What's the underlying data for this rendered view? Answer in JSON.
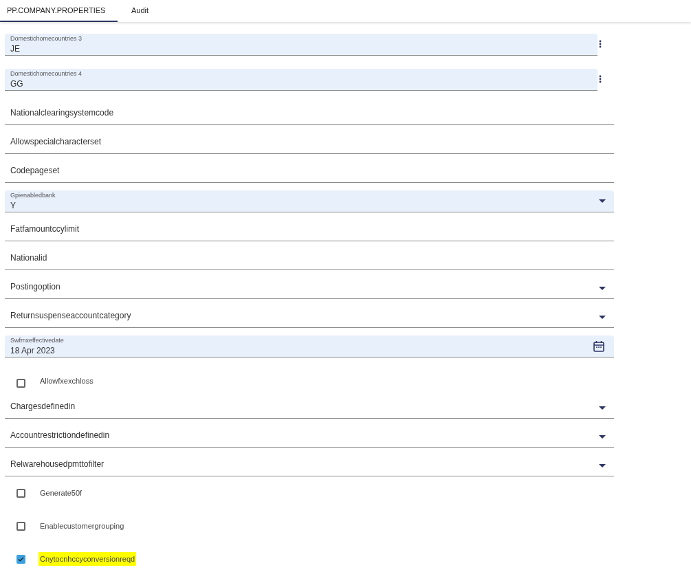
{
  "tabs": [
    {
      "label": "PP.COMPANY.PROPERTIES",
      "selected": true
    },
    {
      "label": "Audit",
      "selected": false
    }
  ],
  "fields": [
    {
      "kind": "menufield",
      "label": "Domestichomecountries 3",
      "value": "JE"
    },
    {
      "kind": "menufield",
      "label": "Domestichomecountries 4",
      "value": "GG"
    },
    {
      "kind": "text",
      "label": "Nationalclearingsystemcode"
    },
    {
      "kind": "text",
      "label": "Allowspecialcharacterset"
    },
    {
      "kind": "text",
      "label": "Codepageset"
    },
    {
      "kind": "dropdown",
      "label": "Gpienabledbank",
      "value": "Y"
    },
    {
      "kind": "text",
      "label": "Fatfamountccylimit"
    },
    {
      "kind": "text",
      "label": "Nationalid"
    },
    {
      "kind": "select",
      "label": "Postingoption"
    },
    {
      "kind": "select",
      "label": "Returnsuspenseaccountcategory"
    },
    {
      "kind": "date",
      "label": "Swfmxeffectivedate",
      "value": "18 Apr 2023"
    },
    {
      "kind": "checkbox",
      "label": "Allowfxexchloss",
      "checked": false,
      "highlighted": false
    },
    {
      "kind": "select",
      "label": "Chargesdefinedin"
    },
    {
      "kind": "select",
      "label": "Accountrestrictiondefinedin"
    },
    {
      "kind": "select",
      "label": "Relwarehousedpmttofilter"
    },
    {
      "kind": "checkbox",
      "label": "Generate50f",
      "checked": false,
      "highlighted": false
    },
    {
      "kind": "checkbox",
      "label": "Enablecustomergrouping",
      "checked": false,
      "highlighted": false
    },
    {
      "kind": "checkbox",
      "label": "Cnytocnhccyconversionreqd",
      "checked": true,
      "highlighted": true
    }
  ]
}
